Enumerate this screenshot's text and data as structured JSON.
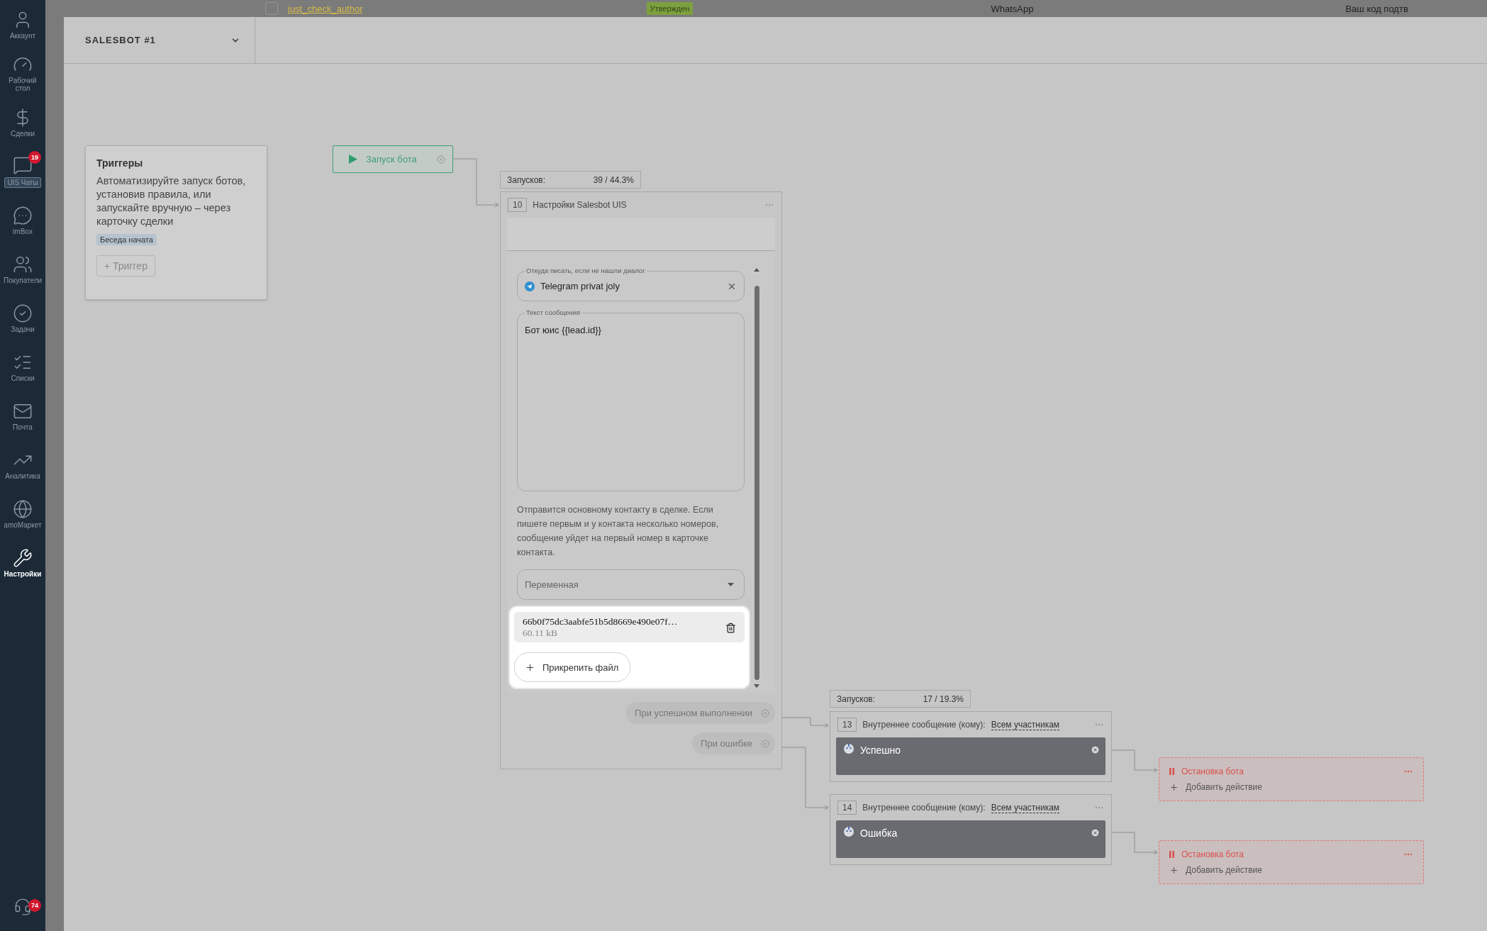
{
  "background_row": {
    "checked": false,
    "author": "just_check_author",
    "status": "Утвержден",
    "channel": "WhatsApp",
    "column_4": "Ваш код подтв"
  },
  "sidebar": {
    "items": [
      {
        "label": "Аккаунт",
        "selected": false,
        "highlighted": false
      },
      {
        "label": "Рабочий стол",
        "selected": false,
        "highlighted": false
      },
      {
        "label": "Сделки",
        "selected": false,
        "highlighted": false
      },
      {
        "label": "UIS Чаты",
        "selected": false,
        "highlighted": true,
        "badge": "19"
      },
      {
        "label": "imBox",
        "selected": false,
        "highlighted": false
      },
      {
        "label": "Покупатели",
        "selected": false,
        "highlighted": false
      },
      {
        "label": "Задачи",
        "selected": false,
        "highlighted": false
      },
      {
        "label": "Списки",
        "selected": false,
        "highlighted": false
      },
      {
        "label": "Почта",
        "selected": false,
        "highlighted": false
      },
      {
        "label": "Аналитика",
        "selected": false,
        "highlighted": false
      },
      {
        "label": "amoМаркет",
        "selected": false,
        "highlighted": false
      },
      {
        "label": "Настройки",
        "selected": true,
        "highlighted": false
      }
    ],
    "bottom_badge": "74"
  },
  "bot": {
    "title": "SALESBOT #1"
  },
  "triggers": {
    "title": "Триггеры",
    "description": "Автоматизируйте запуск ботов, установив правила, или запускайте вручную – через карточку сделки",
    "tags": [
      "Беседа начата"
    ],
    "add_button": "+ Триггер"
  },
  "start_node": {
    "label": "Запуск бота"
  },
  "settings_node": {
    "number": "10",
    "title": "Настройки Salesbot UIS",
    "stats": {
      "label": "Запусков:",
      "value": "39 / 44.3%"
    },
    "from_field": {
      "label": "Откуда писать, если не нашли диалог",
      "value": "Telegram privat joly"
    },
    "message_field": {
      "label": "Текст сообщения",
      "value": "Бот юис {{lead.id}}"
    },
    "hint": "Отправится основному контакту в сделке. Если пишете первым и у контакта несколько номеров, сообщение уйдет на первый номер в карточке контакта.",
    "variable_select": {
      "placeholder": "Переменная"
    },
    "attachment": {
      "name": "66b0f75dc3aabfe51b5d8669e490e07f…",
      "size": "60.11 kB"
    },
    "attach_button": "Прикрепить файл",
    "outputs": [
      "При успешном выполнении",
      "При ошибке"
    ]
  },
  "message_stats": {
    "label": "Запусков:",
    "value": "17 / 19.3%"
  },
  "message_nodes": [
    {
      "number": "13",
      "title": "Внутреннее сообщение (кому):",
      "recipient": "Всем участникам",
      "message": "Успешно"
    },
    {
      "number": "14",
      "title": "Внутреннее сообщение (кому):",
      "recipient": "Всем участникам",
      "message": "Ошибка"
    }
  ],
  "stop_nodes": [
    {
      "title": "Остановка бота",
      "add_action": "Добавить действие"
    },
    {
      "title": "Остановка бота",
      "add_action": "Добавить действие"
    }
  ]
}
